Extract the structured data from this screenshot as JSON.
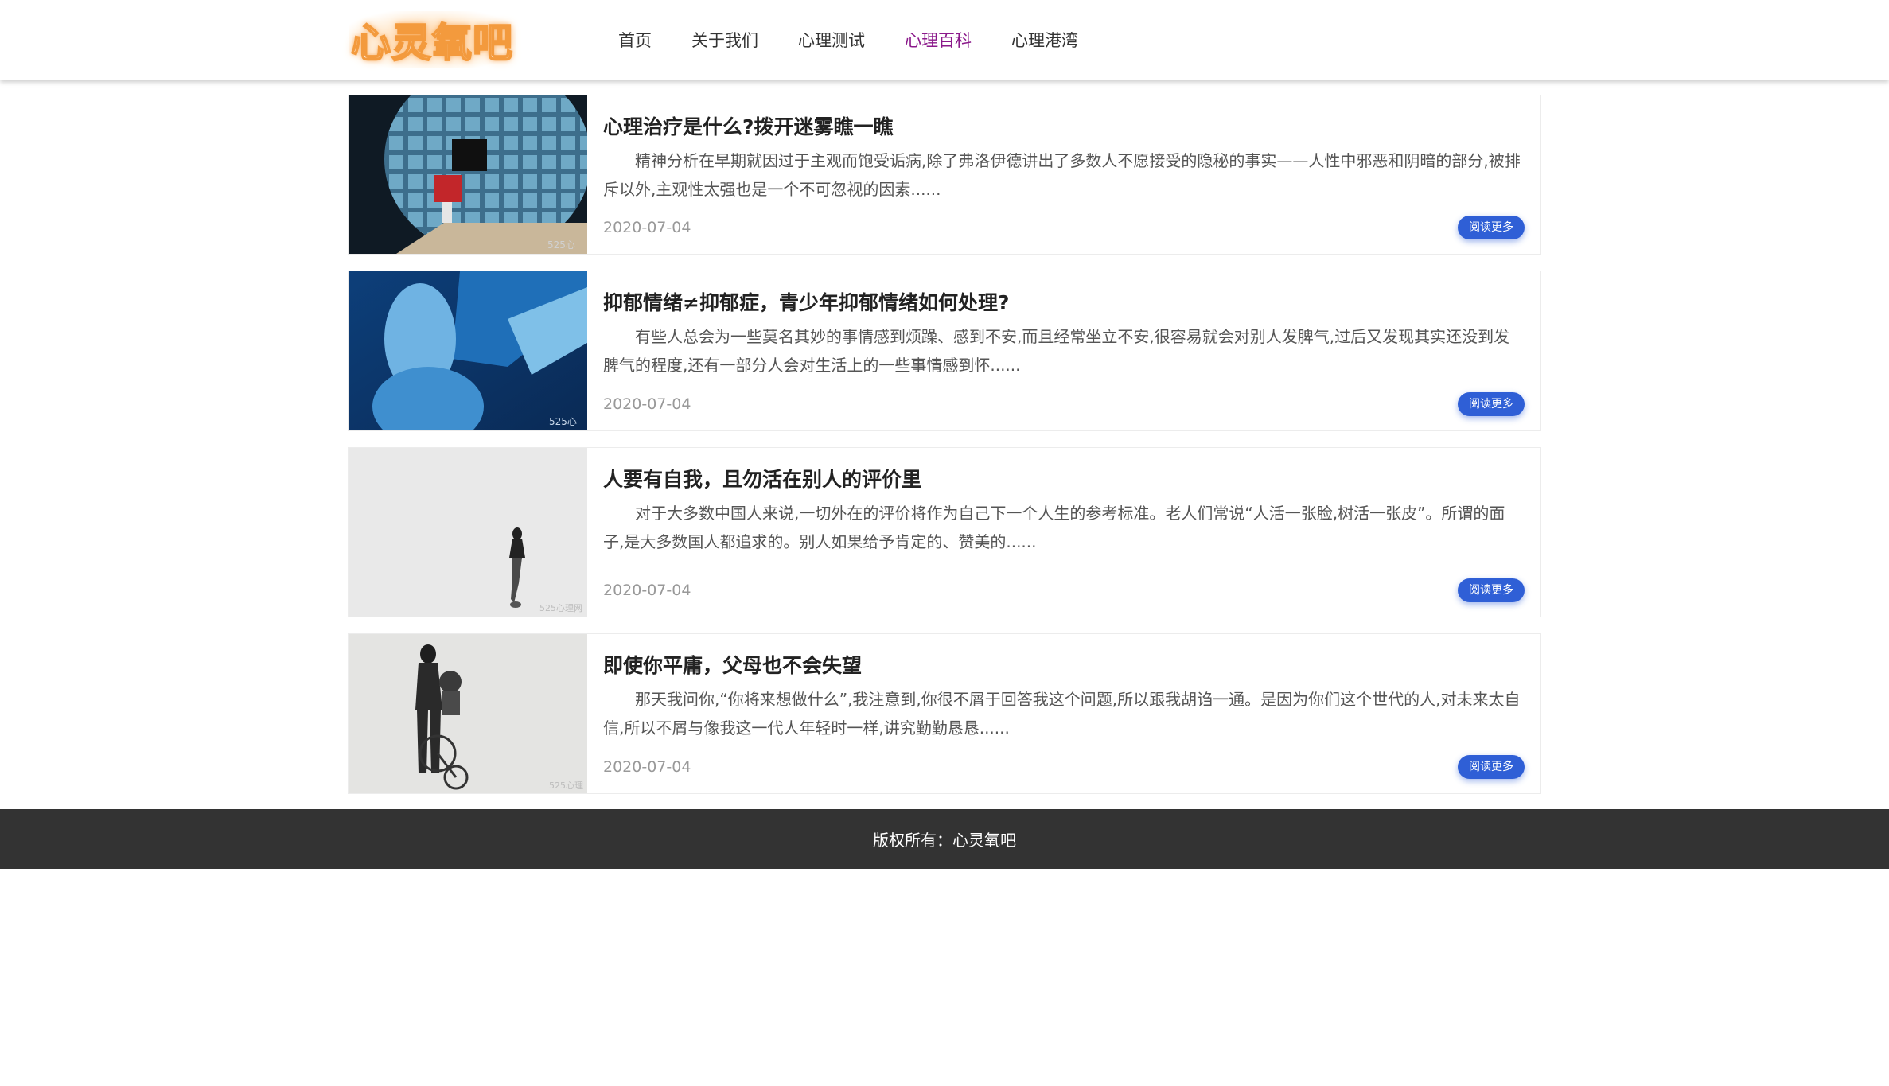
{
  "header": {
    "logo_text": "心灵氧吧",
    "nav": [
      {
        "label": "首页",
        "active": false
      },
      {
        "label": "关于我们",
        "active": false
      },
      {
        "label": "心理测试",
        "active": false
      },
      {
        "label": "心理百科",
        "active": true
      },
      {
        "label": "心理港湾",
        "active": false
      }
    ]
  },
  "articles": [
    {
      "title": "心理治疗是什么?拨开迷雾瞧一瞧",
      "summary": "精神分析在早期就因过于主观而饱受诟病,除了弗洛伊德讲出了多数人不愿接受的隐秘的事实——人性中邪恶和阴暗的部分,被排斥以外,主观性太强也是一个不可忽视的因素......",
      "date": "2020-07-04",
      "read_more": "阅读更多"
    },
    {
      "title": "抑郁情绪≠抑郁症，青少年抑郁情绪如何处理?",
      "summary": "有些人总会为一些莫名其妙的事情感到烦躁、感到不安,而且经常坐立不安,很容易就会对别人发脾气,过后又发现其实还没到发脾气的程度,还有一部分人会对生活上的一些事情感到怀......",
      "date": "2020-07-04",
      "read_more": "阅读更多"
    },
    {
      "title": "人要有自我，且勿活在别人的评价里",
      "summary": "对于大多数中国人来说,一切外在的评价将作为自己下一个人生的参考标准。老人们常说“人活一张脸,树活一张皮”。所谓的面子,是大多数国人都追求的。别人如果给予肯定的、赞美的......",
      "date": "2020-07-04",
      "read_more": "阅读更多"
    },
    {
      "title": "即使你平庸，父母也不会失望",
      "summary": "那天我问你,“你将来想做什么”,我注意到,你很不屑于回答我这个问题,所以跟我胡诌一通。是因为你们这个世代的人,对未来太自信,所以不屑与像我这一代人年轻时一样,讲究勤勤恳恳......",
      "date": "2020-07-04",
      "read_more": "阅读更多"
    }
  ],
  "footer": {
    "copyright": "版权所有：心灵氧吧"
  },
  "colors": {
    "nav_active": "#8b1a8b",
    "button": "#2f5fd6",
    "footer_bg": "#333333"
  }
}
